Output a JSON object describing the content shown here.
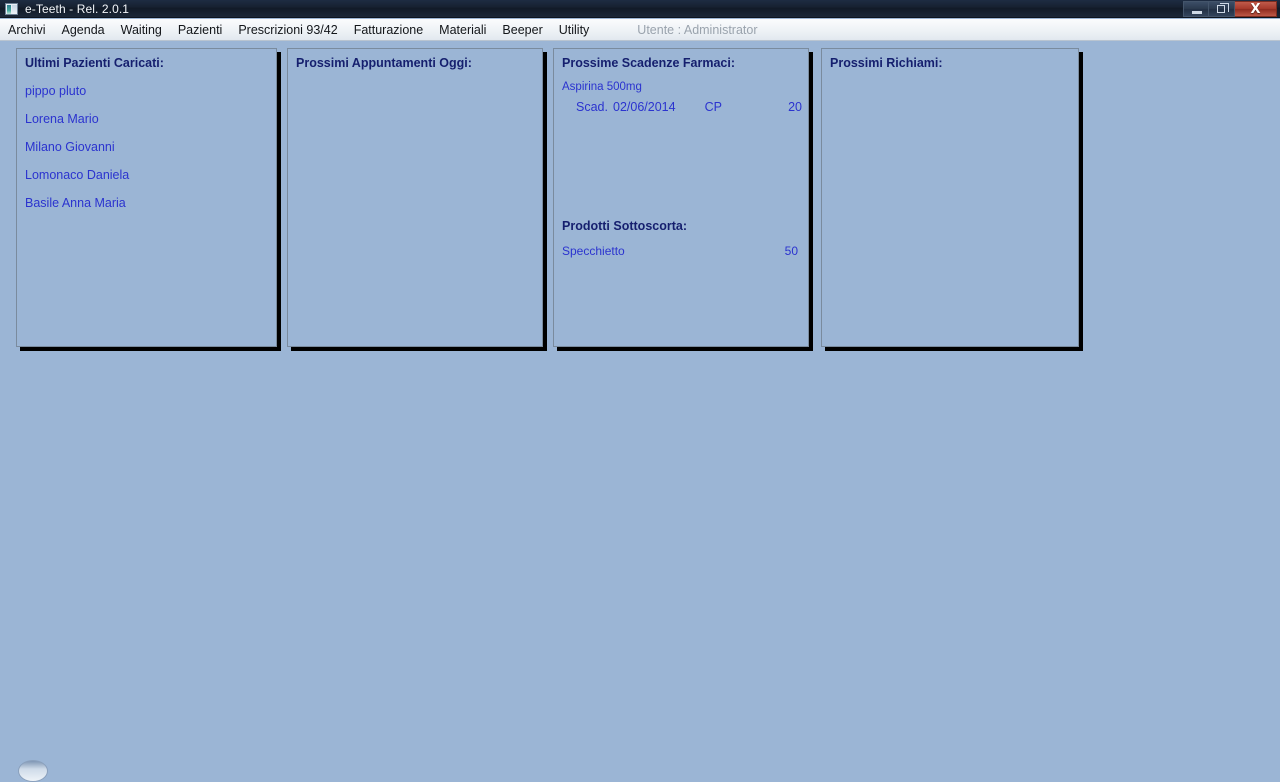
{
  "window": {
    "title": "e-Teeth - Rel. 2.0.1",
    "icon": "app-window-icon",
    "controls": {
      "minimize_label": "Minimize",
      "restore_label": "Restore",
      "close_label": "X"
    }
  },
  "menubar": {
    "items": [
      {
        "label": "Archivi",
        "name": "menu-archivi"
      },
      {
        "label": "Agenda",
        "name": "menu-agenda"
      },
      {
        "label": "Waiting",
        "name": "menu-waiting"
      },
      {
        "label": "Pazienti",
        "name": "menu-pazienti"
      },
      {
        "label": "Prescrizioni 93/42",
        "name": "menu-prescrizioni"
      },
      {
        "label": "Fatturazione",
        "name": "menu-fatturazione"
      },
      {
        "label": "Materiali",
        "name": "menu-materiali"
      },
      {
        "label": "Beeper",
        "name": "menu-beeper"
      },
      {
        "label": "Utility",
        "name": "menu-utility"
      }
    ],
    "user_status": "Utente : Administrator"
  },
  "panels": {
    "recent_patients": {
      "title": "Ultimi Pazienti Caricati:",
      "items": [
        "pippo pluto",
        "Lorena Mario",
        "Milano Giovanni",
        "Lomonaco Daniela",
        "Basile Anna Maria"
      ]
    },
    "appointments": {
      "title": "Prossimi Appuntamenti Oggi:",
      "items": []
    },
    "drug_expiry": {
      "title": "Prossime Scadenze Farmaci:",
      "drugs": [
        {
          "name": "Aspirina 500mg",
          "scad_label": "Scad.",
          "date": "02/06/2014",
          "unit": "CP",
          "quantity": "20"
        }
      ],
      "stock_section": {
        "title": "Prodotti Sottoscorta:",
        "rows": [
          {
            "product": "Specchietto",
            "quantity": "50"
          }
        ]
      }
    },
    "recalls": {
      "title": "Prossimi Richiami:",
      "items": []
    }
  },
  "colors": {
    "desktop_background": "#9bb5d5",
    "panel_background": "#9bb5d5",
    "titlebar": "#16202f",
    "heading_text": "#151f6e",
    "list_text": "#2b33cf",
    "close_button": "#a63a2c"
  }
}
